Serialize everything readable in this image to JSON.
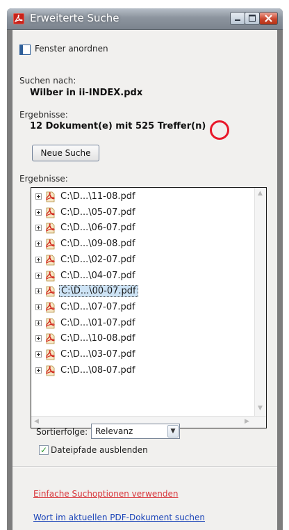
{
  "window": {
    "title": "Erweiterte Suche"
  },
  "toolbar": {
    "arrange_label": "Fenster anordnen"
  },
  "search": {
    "search_for_label": "Suchen nach:",
    "search_for_value": "Wilber in ii-INDEX.pdx",
    "results_label": "Ergebnisse:",
    "results_value": "12 Dokument(e) mit 525 Treffer(n)",
    "new_search_button": "Neue Suche"
  },
  "results": {
    "label": "Ergebnisse:",
    "items": [
      "C:\\D...\\11-08.pdf",
      "C:\\D...\\05-07.pdf",
      "C:\\D...\\06-07.pdf",
      "C:\\D...\\09-08.pdf",
      "C:\\D...\\02-07.pdf",
      "C:\\D...\\04-07.pdf",
      "C:\\D...\\00-07.pdf",
      "C:\\D...\\07-07.pdf",
      "C:\\D...\\01-07.pdf",
      "C:\\D...\\10-08.pdf",
      "C:\\D...\\03-07.pdf",
      "C:\\D...\\08-07.pdf"
    ],
    "selected_index": 6
  },
  "sort": {
    "label": "Sortierfolge:",
    "value": "Relevanz"
  },
  "hide_paths": {
    "label": "Dateipfade ausblenden",
    "checked": true
  },
  "links": {
    "simple_options": "Einfache Suchoptionen verwenden",
    "search_current_pdf": "Wort im aktuellen PDF-Dokument suchen"
  },
  "colors": {
    "title_bar": "#8c949e",
    "link_red": "#d8353a",
    "link_blue": "#1c45b8",
    "annotation_circle": "#e8182a",
    "selection": "#cde3f5"
  },
  "icons": {
    "app": "acrobat-icon",
    "arrange": "window-arrange-icon",
    "file": "pdf-file-icon",
    "expand": "expand-plus-icon"
  }
}
